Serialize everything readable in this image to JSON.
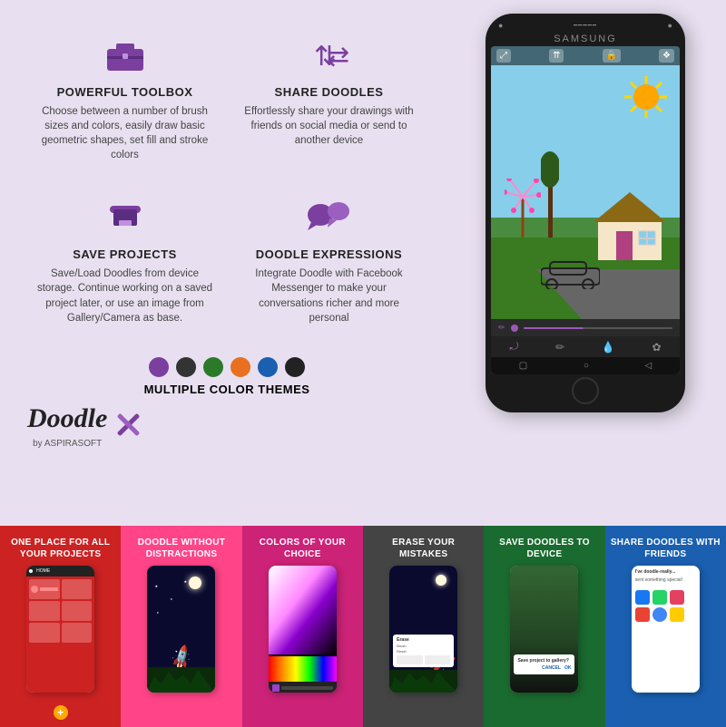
{
  "app": {
    "brand": "Doodle",
    "byline": "by ASPIRASOFT",
    "phone_brand": "SAMSUNG"
  },
  "features": [
    {
      "id": "toolbox",
      "title": "POWERFUL TOOLBOX",
      "description": "Choose between a number of brush sizes and colors, easily draw basic geometric shapes, set fill and stroke colors",
      "icon": "🧰"
    },
    {
      "id": "share-doodles",
      "title": "SHARE DOODLES",
      "description": "Effortlessly share your drawings with friends on social media or send to another device",
      "icon": "↕↔"
    },
    {
      "id": "save-projects",
      "title": "SAVE PROJECTS",
      "description": "Save/Load Doodles from device storage. Continue working on a saved project later, or use an image from Gallery/Camera as base.",
      "icon": "💾"
    },
    {
      "id": "doodle-expressions",
      "title": "DOODLE EXPRESSIONS",
      "description": "Integrate Doodle with Facebook Messenger to make your conversations richer and more personal",
      "icon": "💬"
    }
  ],
  "color_themes": {
    "label": "MULTIPLE COLOR THEMES",
    "colors": [
      "#7b3fa0",
      "#333333",
      "#2a7a2a",
      "#e87020",
      "#1a5fb0",
      "#222222"
    ]
  },
  "bottom_cards": [
    {
      "id": "card-1",
      "title": "ONE PLACE FOR ALL YOUR PROJECTS",
      "bg": "#cc2222",
      "screen_type": "home"
    },
    {
      "id": "card-2",
      "title": "DOODLE WITHOUT DISTRACTIONS",
      "bg": "#ff4488",
      "screen_type": "moon"
    },
    {
      "id": "card-3",
      "title": "COLORS OF YOUR CHOICE",
      "bg": "#cc2277",
      "screen_type": "colors"
    },
    {
      "id": "card-4",
      "title": "ERASE YOUR MISTAKES",
      "bg": "#444444",
      "screen_type": "erase"
    },
    {
      "id": "card-5",
      "title": "SAVE DOODLES TO DEVICE",
      "bg": "#1a6b2f",
      "screen_type": "save"
    },
    {
      "id": "card-6",
      "title": "SHARE DOODLES WITH FRIENDS",
      "bg": "#1a5fb0",
      "screen_type": "share"
    }
  ]
}
